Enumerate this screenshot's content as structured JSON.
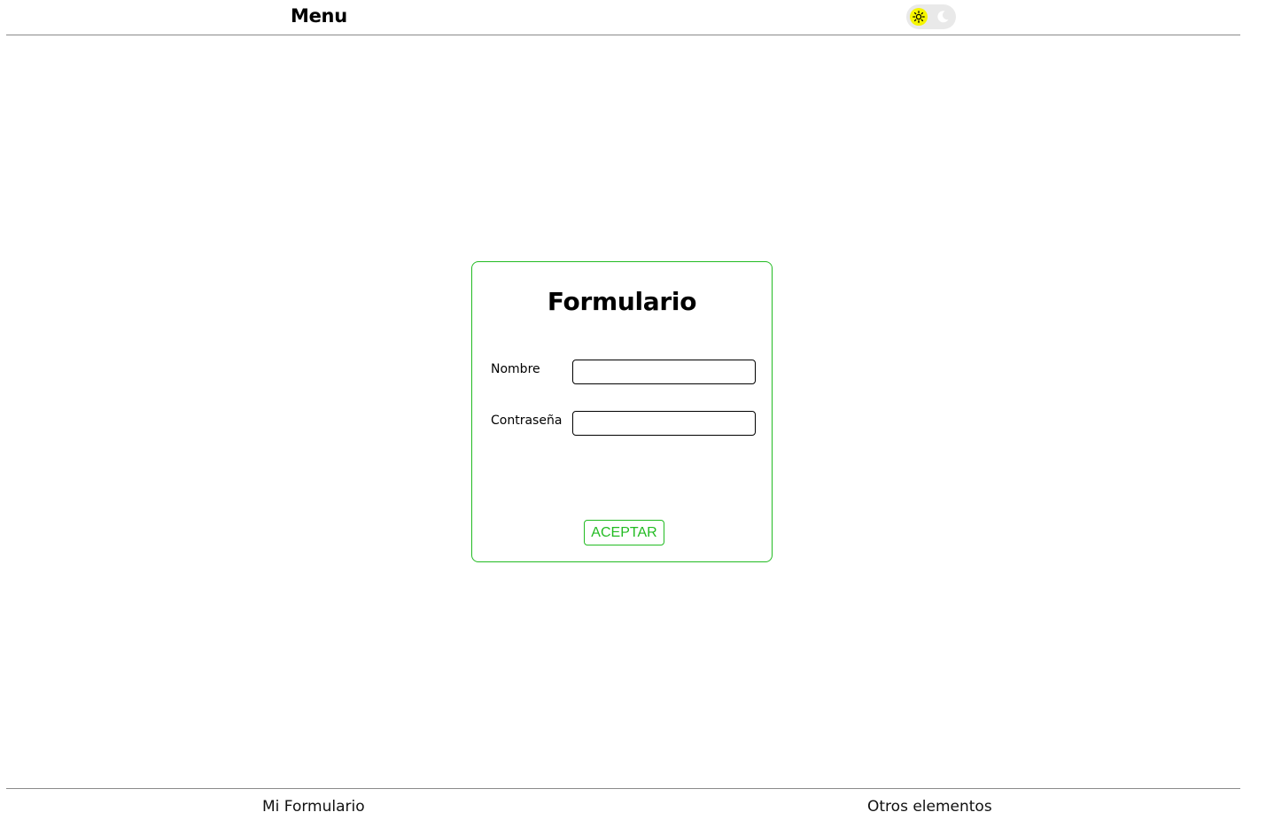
{
  "header": {
    "title": "Menu",
    "theme_toggle": {
      "light_icon": "sun-icon",
      "dark_icon": "moon-icon",
      "active": "light",
      "active_color": "#f5f500"
    }
  },
  "form": {
    "title": "Formulario",
    "fields": [
      {
        "label": "Nombre",
        "value": "",
        "placeholder": ""
      },
      {
        "label": "Contraseña",
        "value": "",
        "placeholder": ""
      }
    ],
    "submit_label": "ACEPTAR",
    "accent_color": "#22bb22"
  },
  "footer": {
    "links": [
      {
        "label": "Mi Formulario"
      },
      {
        "label": "Otros elementos"
      }
    ]
  }
}
